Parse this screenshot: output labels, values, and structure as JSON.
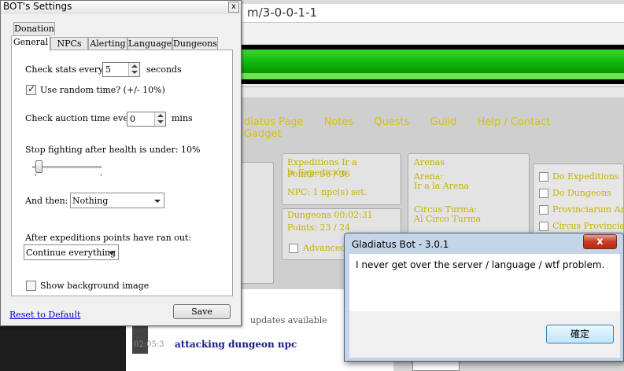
{
  "background": {
    "url": "m/3-0-0-1-1",
    "nav": [
      "diatus Page",
      "Notes",
      "Quests",
      "Guild",
      "Help / Contact",
      "Gadget"
    ],
    "expeditions": {
      "title": "Expeditions Ir a la Expedición",
      "points": "Points: 36 / 36",
      "npc": "NPC: 1 npc(s) set."
    },
    "dungeons": {
      "title": "Dungeons 00:02:31",
      "points": "Points: 23 / 24",
      "advanced": "Advanced"
    },
    "arenas": {
      "title": "Arenas",
      "arena_label": "Arena:",
      "arena_value": "Ir a la Arena",
      "circus_label": "Circus Turma:",
      "circus_value": "Al Circo Turma"
    },
    "checks": [
      "Do Expeditions",
      "Do Dungeons",
      "Provinciarum Arena",
      "Circus Provinciarum"
    ],
    "log": {
      "updates": "updates available",
      "time": "02:05:3",
      "message": "attacking dungeon npc"
    }
  },
  "settings": {
    "title": "BOT's Settings",
    "close": "x",
    "tabs": {
      "donation": "Donation",
      "general": "General",
      "npcs": "NPCs",
      "alerting": "Alerting",
      "language": "Language",
      "dungeons": "Dungeons"
    },
    "check_stats_label": "Check stats every",
    "check_stats_value": "5",
    "check_stats_unit": "seconds",
    "random_time_label": "Use random time? (+/- 10%)",
    "random_time_checked": true,
    "auction_label": "Check auction time every",
    "auction_value": "0",
    "auction_unit": "mins",
    "health_label": "Stop fighting after health is under: 10%",
    "health_slider_value": 10,
    "and_then_label": "And then:",
    "and_then_value": "Nothing",
    "exp_out_label": "After expeditions points have ran out:",
    "exp_out_value": "Continue everything",
    "bg_image_label": "Show background image",
    "bg_image_checked": false,
    "reset_link": "Reset to Default",
    "save_button": "Save"
  },
  "message_box": {
    "title": "Gladiatus Bot - 3.0.1",
    "close": "x",
    "text": "I never get over the server / language / wtf problem.",
    "ok_button": "確定"
  }
}
